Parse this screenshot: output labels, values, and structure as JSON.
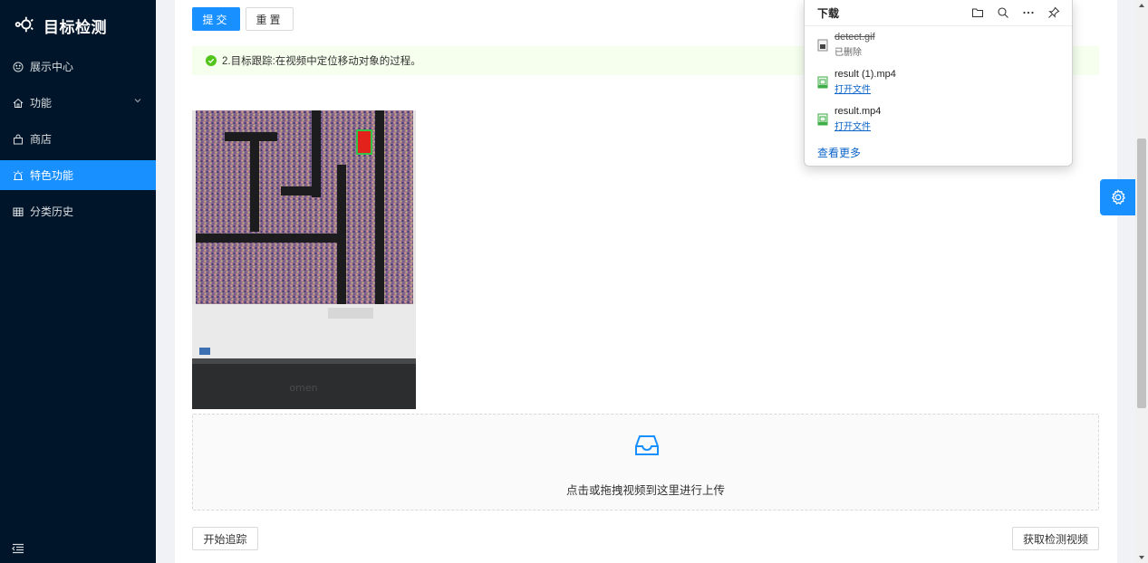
{
  "app": {
    "title": "目标检测"
  },
  "sidebar": {
    "items": [
      {
        "label": "展示中心",
        "icon": "smile-icon"
      },
      {
        "label": "功能",
        "icon": "home-icon",
        "has_submenu": true
      },
      {
        "label": "商店",
        "icon": "shop-icon"
      },
      {
        "label": "特色功能",
        "icon": "alarm-icon",
        "active": true
      },
      {
        "label": "分类历史",
        "icon": "table-icon"
      }
    ],
    "collapse_icon": "menu-fold-icon"
  },
  "toolbar": {
    "submit_label": "提交",
    "reset_label": "重置"
  },
  "alert": {
    "message": "2.目标跟踪:在视频中定位移动对象的过程。",
    "type": "success"
  },
  "preview": {
    "caption": "omen"
  },
  "upload": {
    "text": "点击或拖拽视频到这里进行上传",
    "icon": "inbox-icon"
  },
  "actions": {
    "start_tracking_label": "开始追踪",
    "fetch_video_label": "获取检测视频"
  },
  "downloads": {
    "title": "下载",
    "tools": [
      "folder-icon",
      "search-icon",
      "more-icon",
      "pin-icon"
    ],
    "items": [
      {
        "name": "detect.gif",
        "status": "已删除",
        "deleted": true
      },
      {
        "name": "result (1).mp4",
        "action": "打开文件"
      },
      {
        "name": "result.mp4",
        "action": "打开文件"
      }
    ],
    "more_label": "查看更多"
  },
  "colors": {
    "primary": "#1890ff",
    "sidebar_bg": "#001529",
    "success": "#52c41a",
    "alert_bg": "#f6ffed"
  }
}
